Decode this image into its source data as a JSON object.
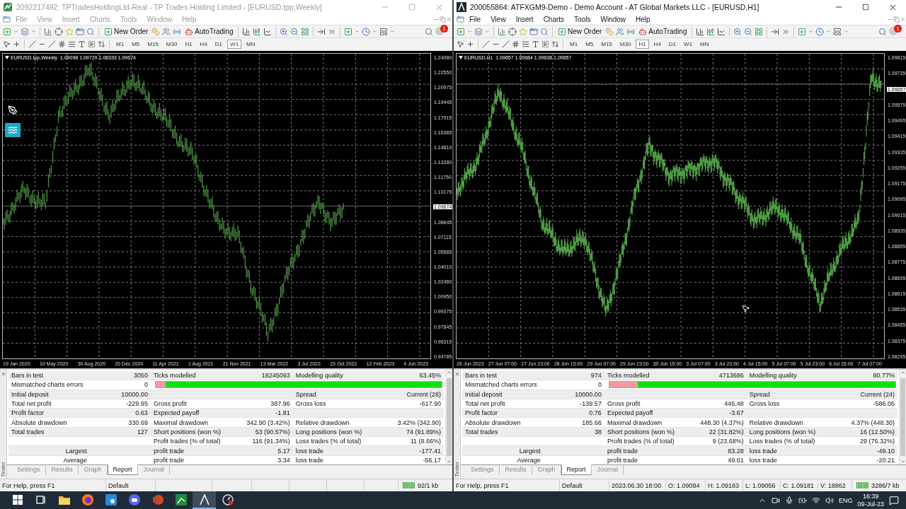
{
  "windows": [
    {
      "title": "2092217492: TPTradesHoldingLtd-Real - TP Trades Holding Limited - [EURUSD.tpp,Weekly]",
      "active": false,
      "menu": [
        "File",
        "View",
        "Insert",
        "Charts",
        "Tools",
        "Window",
        "Help"
      ],
      "toolbar": {
        "new_order": "New Order",
        "auto_trading": "AutoTrading",
        "alert_badge": "1"
      },
      "timeframes": [
        {
          "label": "M1",
          "selected": false
        },
        {
          "label": "M5",
          "selected": false
        },
        {
          "label": "M15",
          "selected": false
        },
        {
          "label": "M30",
          "selected": false
        },
        {
          "label": "H1",
          "selected": false
        },
        {
          "label": "H4",
          "selected": false
        },
        {
          "label": "D1",
          "selected": false
        },
        {
          "label": "W1",
          "selected": true
        },
        {
          "label": "MN",
          "selected": false
        }
      ],
      "chart": {
        "header": "EURUSD.tpp,Weekly  1.09098 1.09729 1.08333 1.09674",
        "prices": [
          {
            "label": "1.24080",
            "kind": "tick"
          },
          {
            "label": "1.22550",
            "kind": "tick"
          },
          {
            "label": "1.20975",
            "kind": "tick"
          },
          {
            "label": "1.19445",
            "kind": "tick"
          },
          {
            "label": "1.17915",
            "kind": "tick"
          },
          {
            "label": "1.16385",
            "kind": "tick"
          },
          {
            "label": "1.14810",
            "kind": "tick"
          },
          {
            "label": "1.13280",
            "kind": "tick"
          },
          {
            "label": "1.11750",
            "kind": "tick"
          },
          {
            "label": "1.10175",
            "kind": "tick"
          },
          {
            "label": "1.09674",
            "kind": "current"
          },
          {
            "label": "1.08645",
            "kind": "tick"
          },
          {
            "label": "1.07115",
            "kind": "tick"
          },
          {
            "label": "1.05585",
            "kind": "tick"
          },
          {
            "label": "1.04010",
            "kind": "tick"
          },
          {
            "label": "1.02480",
            "kind": "tick"
          },
          {
            "label": "1.00950",
            "kind": "tick"
          },
          {
            "label": "0.99375",
            "kind": "tick"
          },
          {
            "label": "0.97845",
            "kind": "tick"
          },
          {
            "label": "0.96315",
            "kind": "tick"
          },
          {
            "label": "0.94785",
            "kind": "tick"
          }
        ],
        "dates": [
          "19 Jan 2020",
          "10 May 2020",
          "30 Aug 2020",
          "20 Dec 2020",
          "11 Apr 2021",
          "1 Aug 2021",
          "21 Nov 2021",
          "13 Mar 2022",
          "3 Jul 2022",
          "23 Oct 2022",
          "12 Feb 2023",
          "4 Jun 2023"
        ]
      },
      "tester": {
        "side_label": "Tester",
        "rows": [
          {
            "kind": "plain",
            "c1": "Bars in test",
            "c2": "3050",
            "c3": "Ticks modelled",
            "c4": "18245093",
            "c5": "Modelling quality",
            "c6": "63.45%"
          },
          {
            "kind": "bar",
            "c1": "Mismatched charts errors",
            "c2": "0",
            "level": 0.965
          },
          {
            "kind": "plain",
            "c1": "Initial deposit",
            "c2": "10000.00",
            "c5": "Spread",
            "c6": "Current (28)"
          },
          {
            "kind": "plain",
            "c1": "Total net profit",
            "c2": "-229.95",
            "c3": "Gross profit",
            "c4": "387.96",
            "c5": "Gross loss",
            "c6": "-617.90"
          },
          {
            "kind": "plain",
            "c1": "Profit factor",
            "c2": "0.63",
            "c3": "Expected payoff",
            "c4": "-1.81"
          },
          {
            "kind": "plain",
            "c1": "Absolute drawdown",
            "c2": "330.69",
            "c3": "Maximal drawdown",
            "c4": "342.90 (3.42%)",
            "c5": "Relative drawdown",
            "c6": "3.42% (342.90)"
          },
          {
            "kind": "plain",
            "c1": "Total trades",
            "c2": "127",
            "c3": "Short positions (won %)",
            "c4": "53 (90.57%)",
            "c5": "Long positions (won %)",
            "c6": "74 (91.89%)"
          },
          {
            "kind": "plain",
            "c3": "Profit trades (% of total)",
            "c4": "116 (91.34%)",
            "c5": "Loss trades (% of total)",
            "c6": "11 (8.66%)"
          },
          {
            "kind": "sub",
            "c1": "Largest",
            "c3": "profit trade",
            "c4": "5.17",
            "c5": "loss trade",
            "c6": "-177.41"
          },
          {
            "kind": "sub",
            "c1": "Average",
            "c3": "profit trade",
            "c4": "3.34",
            "c5": "loss trade",
            "c6": "-56.17"
          }
        ],
        "tabs": [
          {
            "label": "Settings",
            "selected": false
          },
          {
            "label": "Results",
            "selected": false
          },
          {
            "label": "Graph",
            "selected": false
          },
          {
            "label": "Report",
            "selected": true
          },
          {
            "label": "Journal",
            "selected": false
          }
        ]
      },
      "status": {
        "fields": [
          "For Help, press F1",
          "Default"
        ],
        "traffic": "92/1 kb"
      }
    },
    {
      "title": "200055864: ATFXGM9-Demo - Demo Account - AT Global Markets LLC - [EURUSD,H1]",
      "active": true,
      "menu": [
        "File",
        "View",
        "Insert",
        "Charts",
        "Tools",
        "Window",
        "Help"
      ],
      "toolbar": {
        "new_order": "New Order",
        "auto_trading": "AutoTrading",
        "alert_badge": "1"
      },
      "timeframes": [
        {
          "label": "M1",
          "selected": false
        },
        {
          "label": "M5",
          "selected": false
        },
        {
          "label": "M15",
          "selected": false
        },
        {
          "label": "M30",
          "selected": false
        },
        {
          "label": "H1",
          "selected": true
        },
        {
          "label": "H4",
          "selected": false
        },
        {
          "label": "D1",
          "selected": false
        },
        {
          "label": "W1",
          "selected": false
        },
        {
          "label": "MN",
          "selected": false
        }
      ],
      "chart": {
        "header": "EURUSD,H1  1.09657 1.09684 1.09638 1.09657",
        "prices": [
          {
            "label": "1.09815",
            "kind": "tick"
          },
          {
            "label": "1.09735",
            "kind": "tick"
          },
          {
            "label": "1.09657",
            "kind": "current"
          },
          {
            "label": "1.09575",
            "kind": "tick"
          },
          {
            "label": "1.09495",
            "kind": "tick"
          },
          {
            "label": "1.09415",
            "kind": "tick"
          },
          {
            "label": "1.09335",
            "kind": "tick"
          },
          {
            "label": "1.09255",
            "kind": "tick"
          },
          {
            "label": "1.09175",
            "kind": "tick"
          },
          {
            "label": "1.09095",
            "kind": "tick"
          },
          {
            "label": "1.09015",
            "kind": "tick"
          },
          {
            "label": "1.08935",
            "kind": "tick"
          },
          {
            "label": "1.08855",
            "kind": "tick"
          },
          {
            "label": "1.08775",
            "kind": "tick"
          },
          {
            "label": "1.08695",
            "kind": "tick"
          },
          {
            "label": "1.08615",
            "kind": "tick"
          },
          {
            "label": "1.08535",
            "kind": "tick"
          },
          {
            "label": "1.08455",
            "kind": "tick"
          },
          {
            "label": "1.08375",
            "kind": "tick"
          },
          {
            "label": "1.08295",
            "kind": "tick"
          }
        ],
        "dates": [
          "26 Jun 2023",
          "27 Jun 07:00",
          "27 Jun 23:00",
          "28 Jun 15:00",
          "29 Jun 07:00",
          "29 Jun 23:00",
          "30 Jun 15:00",
          "3 Jul 07:00",
          "3 Jul 23:00",
          "4 Jul 15:00",
          "5 Jul 07:00",
          "5 Jul 23:00",
          "6 Jul 15:00",
          "7 Jul 07:00"
        ]
      },
      "tester": {
        "side_label": "Tester",
        "rows": [
          {
            "kind": "plain",
            "c1": "Bars in test",
            "c2": "974",
            "c3": "Ticks modelled",
            "c4": "4713686",
            "c5": "Modelling quality",
            "c6": "80.77%"
          },
          {
            "kind": "bar",
            "c1": "Mismatched charts errors",
            "c2": "0",
            "level": 0.9
          },
          {
            "kind": "plain",
            "c1": "Initial deposit",
            "c2": "10000.00",
            "c5": "Spread",
            "c6": "Current (24)"
          },
          {
            "kind": "plain",
            "c1": "Total net profit",
            "c2": "-139.57",
            "c3": "Gross profit",
            "c4": "446.48",
            "c5": "Gross loss",
            "c6": "-586.05"
          },
          {
            "kind": "plain",
            "c1": "Profit factor",
            "c2": "0.76",
            "c3": "Expected payoff",
            "c4": "-3.67"
          },
          {
            "kind": "plain",
            "c1": "Absolute drawdown",
            "c2": "185.66",
            "c3": "Maximal drawdown",
            "c4": "448.30 (4.37%)",
            "c5": "Relative drawdown",
            "c6": "4.37% (448.30)"
          },
          {
            "kind": "plain",
            "c1": "Total trades",
            "c2": "38",
            "c3": "Short positions (won %)",
            "c4": "22 (31.82%)",
            "c5": "Long positions (won %)",
            "c6": "16 (12.50%)"
          },
          {
            "kind": "plain",
            "c3": "Profit trades (% of total)",
            "c4": "9 (23.68%)",
            "c5": "Loss trades (% of total)",
            "c6": "29 (76.32%)"
          },
          {
            "kind": "sub",
            "c1": "Largest",
            "c3": "profit trade",
            "c4": "83.28",
            "c5": "loss trade",
            "c6": "-49.10"
          },
          {
            "kind": "sub",
            "c1": "Average",
            "c3": "profit trade",
            "c4": "49.61",
            "c5": "loss trade",
            "c6": "-20.21"
          }
        ],
        "tabs": [
          {
            "label": "Settings",
            "selected": false
          },
          {
            "label": "Results",
            "selected": false
          },
          {
            "label": "Graph",
            "selected": false
          },
          {
            "label": "Report",
            "selected": true
          },
          {
            "label": "Journal",
            "selected": false
          }
        ]
      },
      "status": {
        "fields": [
          "For Help, press F1",
          "Default",
          "2023.06.30 18:00",
          "O: 1.09094",
          "H: 1.09183",
          "L: 1.09056",
          "C: 1.09181",
          "V: 18862"
        ],
        "traffic": "3286/7 kb"
      }
    }
  ],
  "taskbar": {
    "apps": [
      {
        "kind": "explorer",
        "selected": false
      },
      {
        "kind": "firefox",
        "selected": false
      },
      {
        "kind": "store",
        "selected": false
      },
      {
        "kind": "discord",
        "selected": false
      },
      {
        "kind": "powerpoint",
        "selected": false
      },
      {
        "kind": "spreadsheet",
        "selected": false
      },
      {
        "kind": "terminal",
        "selected": true
      },
      {
        "kind": "recorder",
        "selected": false
      }
    ],
    "language": "ENG",
    "time": "16:39",
    "date": "09-Jul-23"
  }
}
